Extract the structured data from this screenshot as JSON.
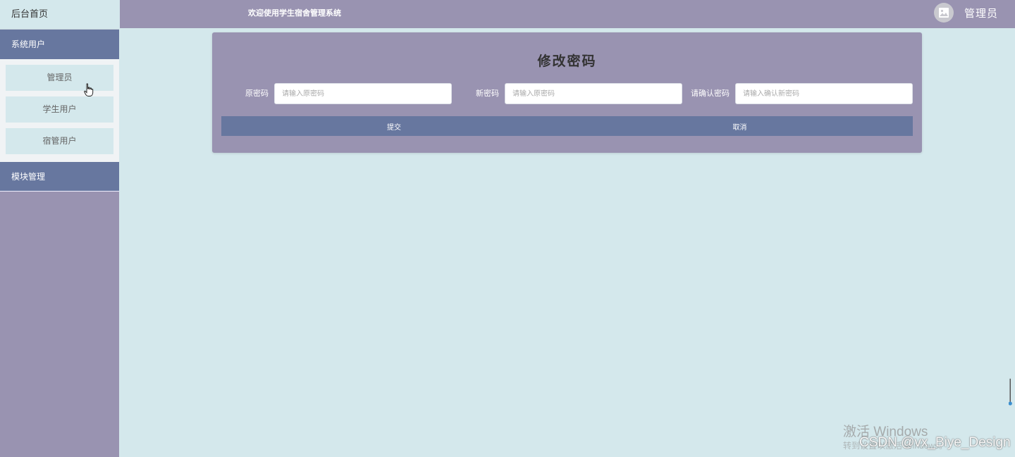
{
  "sidebar": {
    "home": "后台首页",
    "groups": [
      {
        "label": "系统用户",
        "items": [
          "管理员",
          "学生用户",
          "宿管用户"
        ]
      },
      {
        "label": "模块管理"
      }
    ]
  },
  "header": {
    "title": "欢迎使用学生宿舍管理系统",
    "user": "管理员"
  },
  "form": {
    "title": "修改密码",
    "fields": [
      {
        "label": "原密码",
        "placeholder": "请输入原密码"
      },
      {
        "label": "新密码",
        "placeholder": "请输入原密码"
      },
      {
        "label": "请确认密码",
        "placeholder": "请输入确认新密码"
      }
    ],
    "submit_label": "提交",
    "cancel_label": "取消"
  },
  "watermark": {
    "activate_title": "激活 Windows",
    "activate_sub": "转到设置以激活 Windows。",
    "csdn": "CSDN @vx_Biye_Design"
  },
  "colors": {
    "accent": "#67779f",
    "panel": "#9993b1",
    "background": "#d4e8ec"
  }
}
